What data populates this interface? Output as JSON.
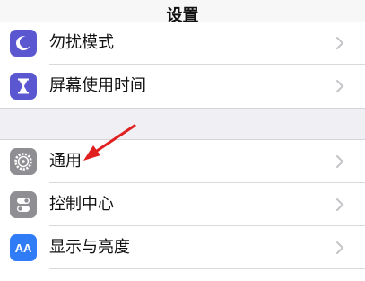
{
  "nav": {
    "title": "设置"
  },
  "group1": {
    "items": [
      {
        "label": "勿扰模式",
        "icon": "moon-icon",
        "color": "#5b57d1"
      },
      {
        "label": "屏幕使用时间",
        "icon": "hourglass-icon",
        "color": "#5b57d1"
      }
    ]
  },
  "group2": {
    "items": [
      {
        "label": "通用",
        "icon": "gear-icon",
        "color": "#8e8e93"
      },
      {
        "label": "控制中心",
        "icon": "toggles-icon",
        "color": "#8e8e93"
      },
      {
        "label": "显示与亮度",
        "icon": "text-size-icon",
        "color": "#2f7cf6",
        "icon_text": "AA"
      }
    ]
  },
  "annotation": {
    "arrow_color": "#e02020"
  }
}
